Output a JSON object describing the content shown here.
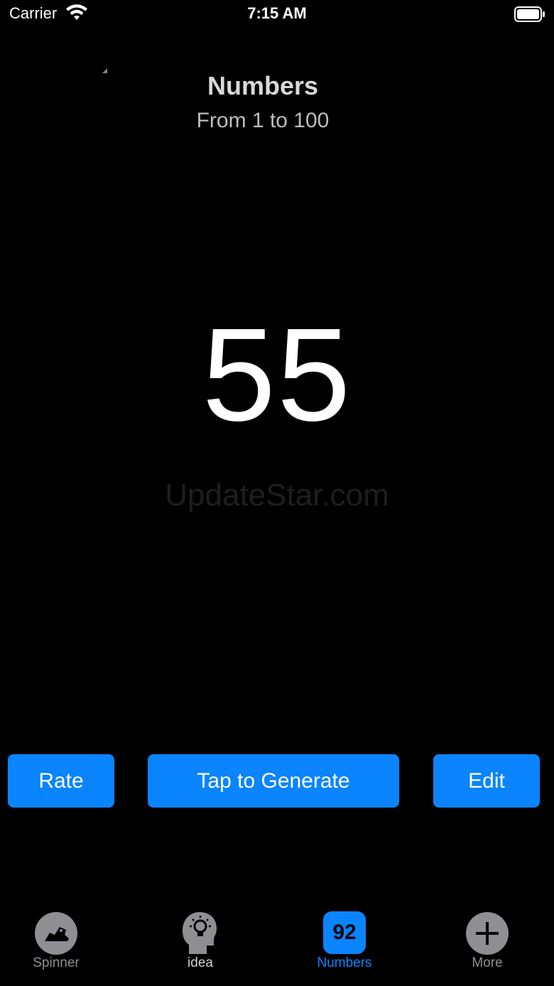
{
  "status_bar": {
    "carrier": "Carrier",
    "time": "7:15 AM",
    "wifi_icon": "wifi-icon",
    "battery_icon": "battery-icon"
  },
  "header": {
    "title": "Numbers",
    "subtitle": "From 1 to 100"
  },
  "main": {
    "generated_number": "55",
    "watermark": "UpdateStar.com"
  },
  "actions": {
    "rate_label": "Rate",
    "generate_label": "Tap to Generate",
    "edit_label": "Edit"
  },
  "tab_bar": {
    "items": [
      {
        "label": "Spinner",
        "icon": "spinner-icon",
        "active": false
      },
      {
        "label": "idea",
        "icon": "idea-head-icon",
        "active": false
      },
      {
        "label": "Numbers",
        "icon": "numbers-icon",
        "badge": "92",
        "active": true
      },
      {
        "label": "More",
        "icon": "plus-icon",
        "active": false
      }
    ]
  },
  "colors": {
    "background": "#000000",
    "accent": "#0a84ff",
    "inactive_tab": "#8e8e93"
  }
}
